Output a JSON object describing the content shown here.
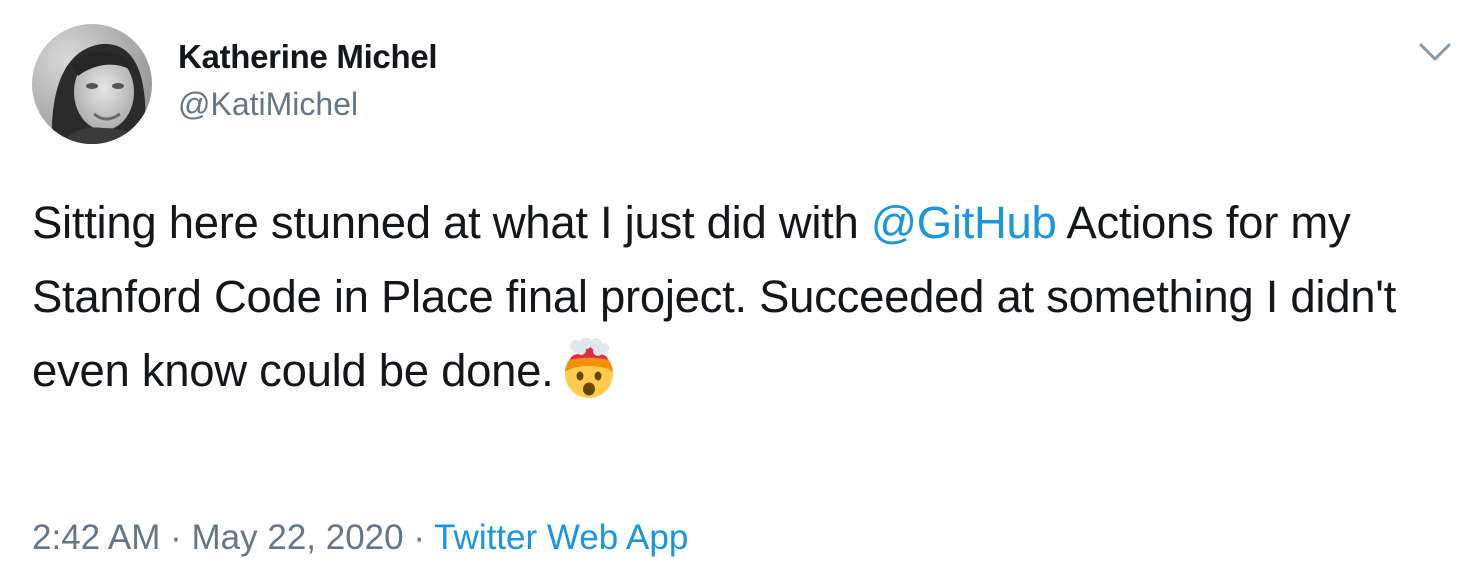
{
  "author": {
    "display_name": "Katherine Michel",
    "handle": "@KatiMichel"
  },
  "icons": {
    "menu": "chevron-down-icon",
    "emoji": "exploding-head-emoji"
  },
  "tweet": {
    "text_before_mention": "Sitting here stunned at what I just did with ",
    "mention": "@GitHub",
    "text_after_mention": " Actions for my Stanford Code in Place final project. Succeeded at something I didn't even know could be done.",
    "emoji_alt": "🤯"
  },
  "meta": {
    "time": "2:42 AM",
    "separator": " · ",
    "date": "May 22, 2020",
    "source": "Twitter Web App"
  },
  "colors": {
    "text": "#14171a",
    "secondary": "#657786",
    "link": "#1b95e0",
    "background": "#ffffff"
  }
}
